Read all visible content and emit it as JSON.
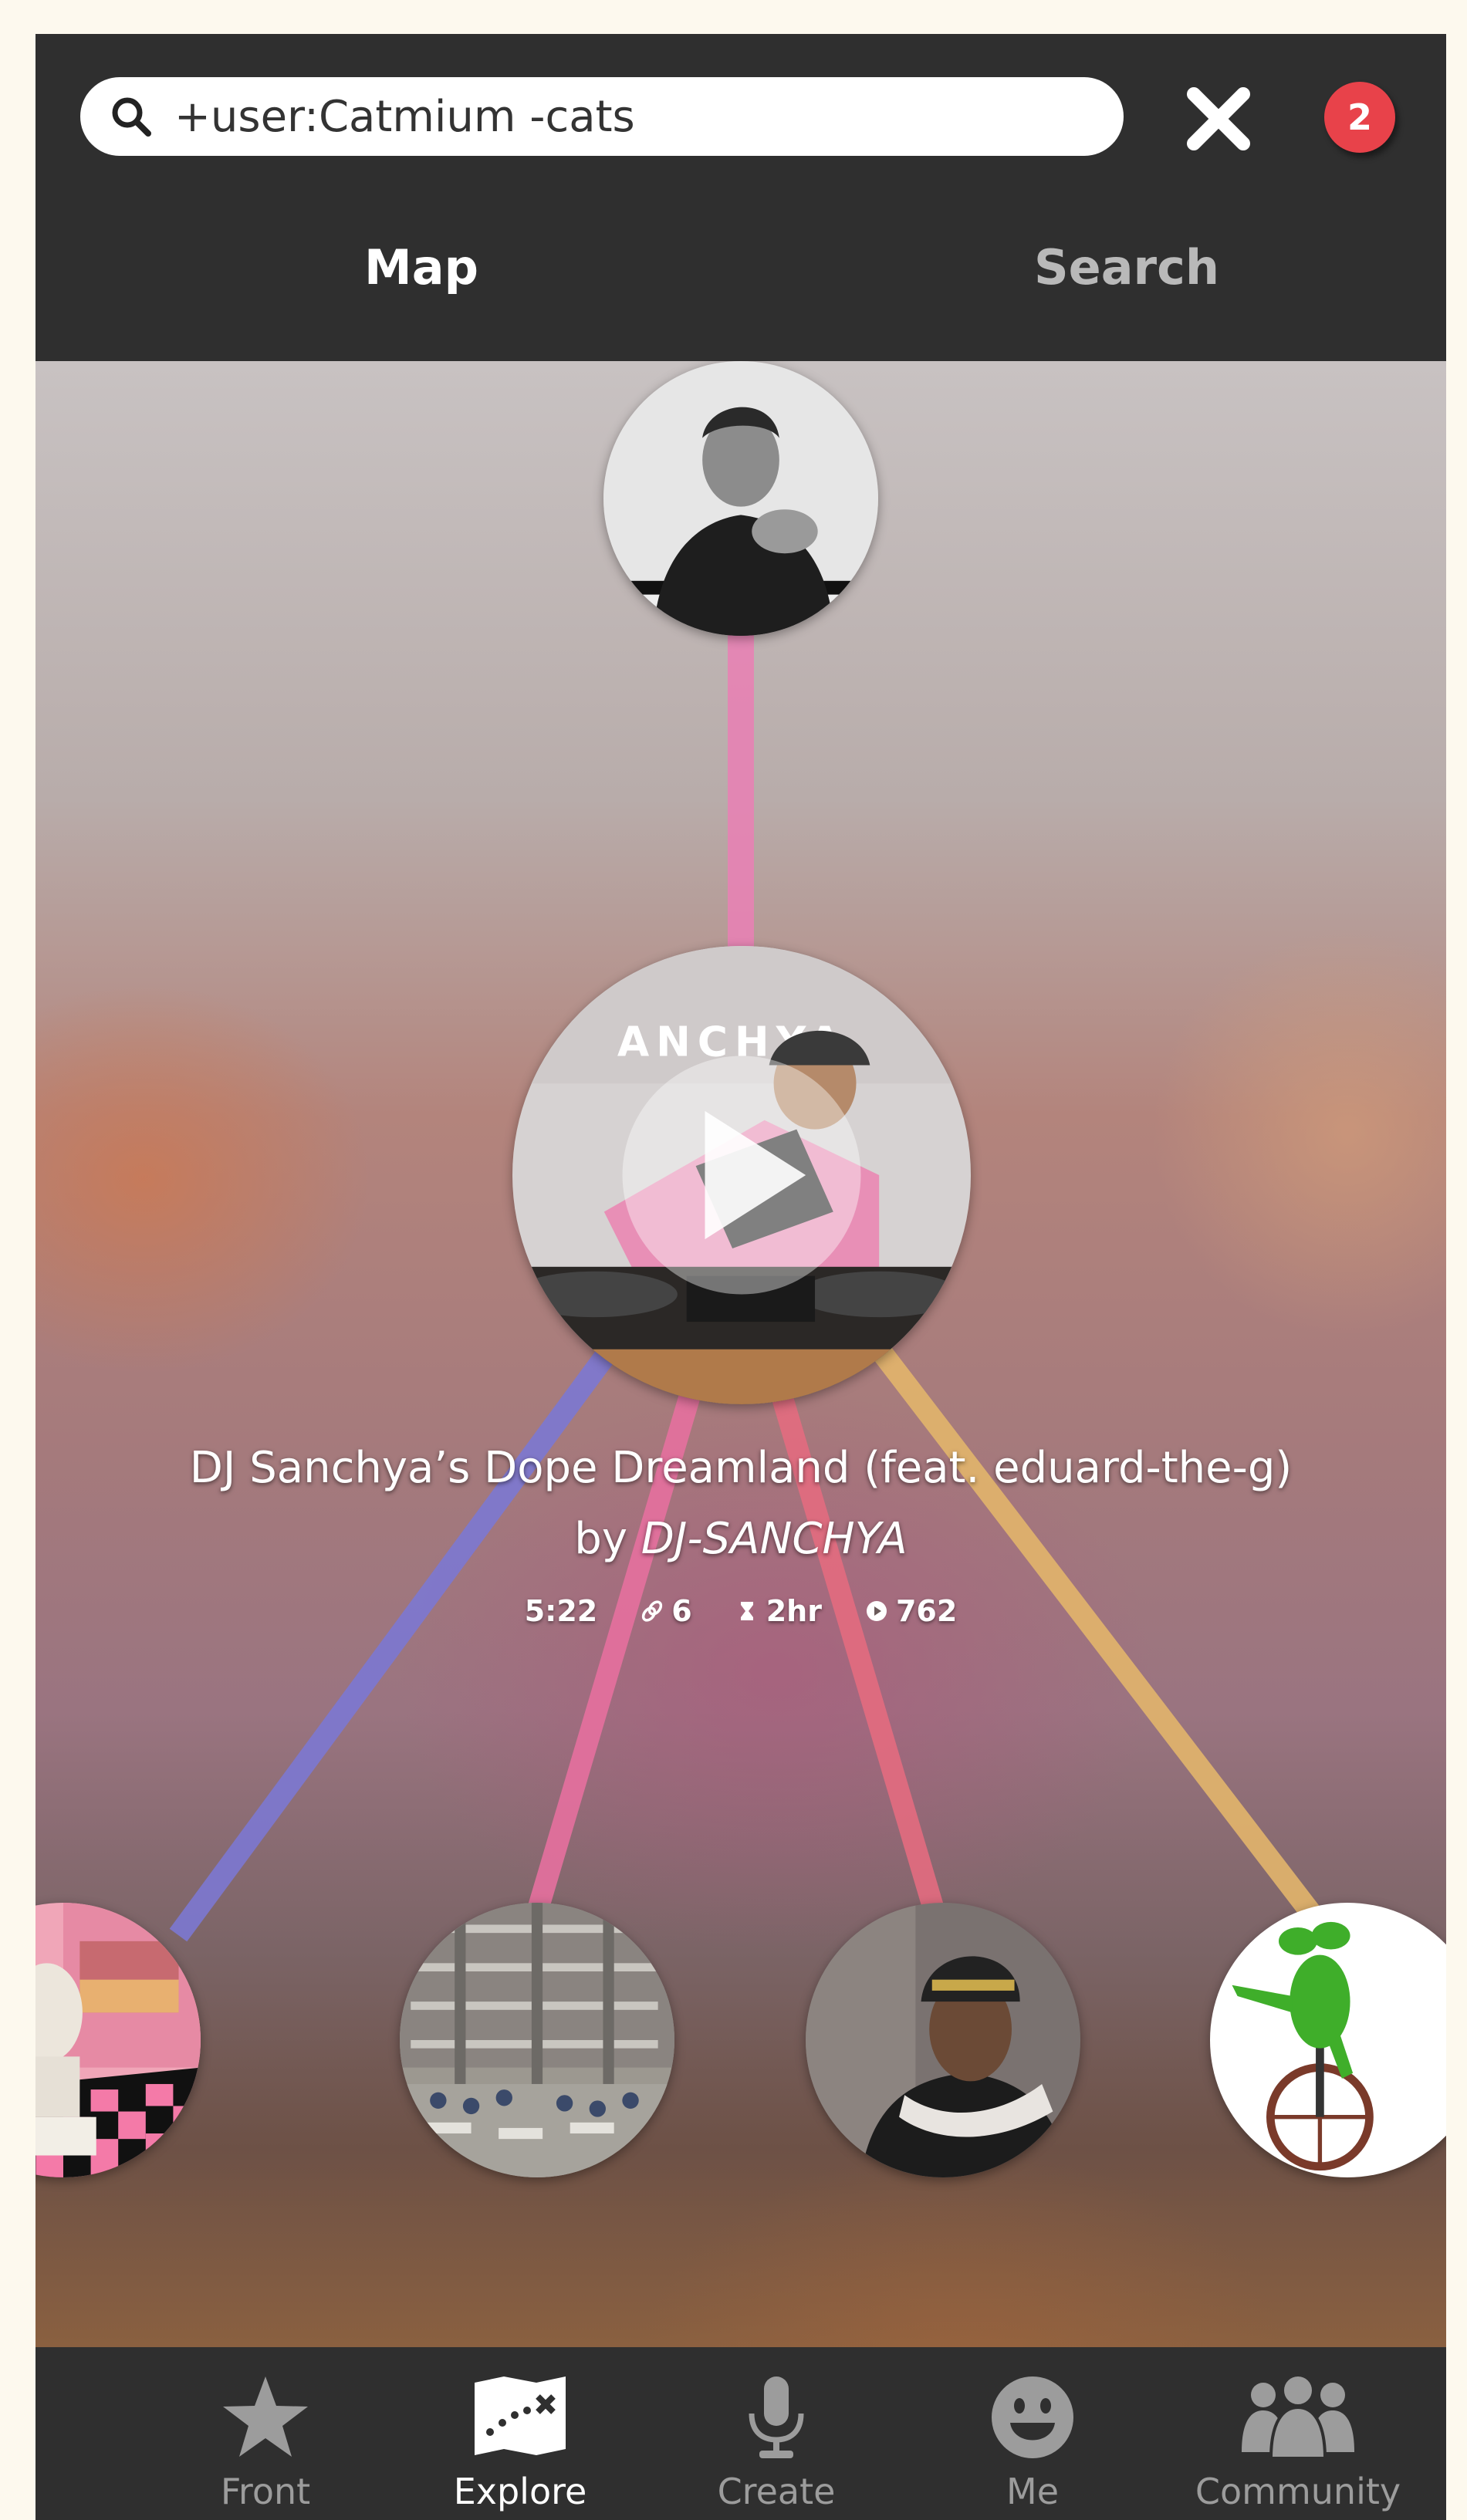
{
  "search": {
    "query": "+user:Catmium -cats",
    "icon": "search-icon"
  },
  "header": {
    "close_icon": "close-icon",
    "notification_count": "2"
  },
  "tabs": [
    {
      "label": "Map",
      "active": true
    },
    {
      "label": "Search",
      "active": false
    }
  ],
  "track": {
    "title": "DJ Sanchya’s Dope Dreamland (feat. eduard-the-g)",
    "by_prefix": "by ",
    "artist": "DJ-SANCHYA",
    "duration": "5:22",
    "links": "6",
    "age": "2hr",
    "plays": "762",
    "cover_text": "ANCHYA"
  },
  "link_colors": {
    "top": "#e782b4",
    "left": "#7c78d2",
    "mid_left": "#e5709f",
    "mid_right": "#e36c80",
    "right": "#e2b56c"
  },
  "nav": [
    {
      "label": "Front",
      "icon": "star-icon",
      "active": false
    },
    {
      "label": "Explore",
      "icon": "map-icon",
      "active": true
    },
    {
      "label": "Create",
      "icon": "microphone-icon",
      "active": false
    },
    {
      "label": "Me",
      "icon": "smiley-icon",
      "active": false
    },
    {
      "label": "Community",
      "icon": "people-icon",
      "active": false
    }
  ],
  "colors": {
    "bar_background": "#2f2f2f",
    "badge": "#e8424a",
    "page_background": "#fdf9ee"
  }
}
